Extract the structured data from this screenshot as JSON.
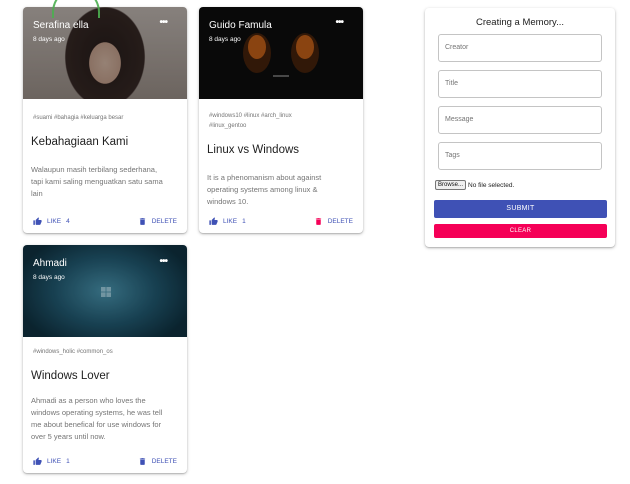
{
  "posts": [
    {
      "creator": "Serafina ella",
      "time": "8 days ago",
      "tags": "#suami #bahagia #keluarga besar",
      "title": "Kebahagiaan Kami",
      "message_lines": [
        "Walaupun masih terbilang sederhana,",
        "tapi kami saling menguatkan satu sama",
        "lain"
      ],
      "like_label": "LIKE",
      "likes": "4",
      "delete_label": "DELETE"
    },
    {
      "creator": "Guido Famula",
      "time": "8 days ago",
      "tags_lines": [
        "#windows10 #linux #arch_linux",
        "#linux_gentoo"
      ],
      "title": "Linux vs Windows",
      "message_lines": [
        "It is a phenomanism about against",
        "operating systems among linux &",
        "windows 10."
      ],
      "like_label": "LIKE",
      "likes": "1",
      "delete_label": "DELETE"
    },
    {
      "creator": "Ahmadi",
      "time": "8 days ago",
      "tags": "#windows_holic #common_os",
      "title": "Windows Lover",
      "message_lines": [
        "Ahmadi as a person who loves the",
        "windows operating systems, he was tell",
        "me about benefical for use windows for",
        "over 5 years until now."
      ],
      "like_label": "LIKE",
      "likes": "1",
      "delete_label": "DELETE"
    }
  ],
  "form": {
    "title": "Creating a Memory...",
    "creator_placeholder": "Creator",
    "title_placeholder": "Title",
    "message_placeholder": "Message",
    "tags_placeholder": "Tags",
    "browse_label": "Browse...",
    "file_status": "No file selected.",
    "submit_label": "SUBMIT",
    "clear_label": "CLEAR"
  },
  "colors": {
    "primary": "#3f51b5",
    "secondary": "#f50057"
  }
}
